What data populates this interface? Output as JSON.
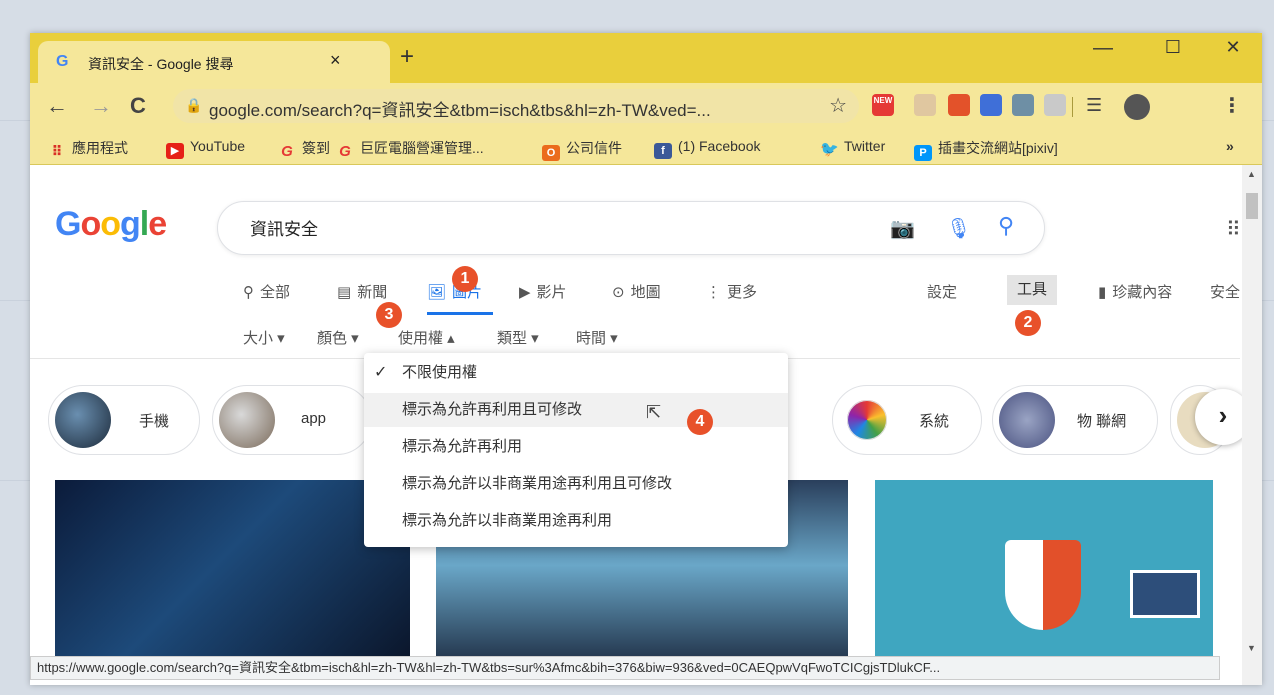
{
  "browser": {
    "tab_title": "資訊安全 - Google 搜尋",
    "tab_favicon": "G",
    "tab_close": "×",
    "new_tab": "+",
    "window_controls": {
      "minimize": "—",
      "maximize": "☐",
      "close": "✕"
    },
    "url": "google.com/search?q=資訊安全&tbm=isch&tbs&hl=zh-TW&ved=...",
    "ext_new_label": "NEW",
    "bookmarks": [
      {
        "label": "應用程式",
        "icon": "apps-grid-icon"
      },
      {
        "label": "YouTube",
        "icon": "youtube-icon"
      },
      {
        "label": "簽到",
        "icon": "g-logo-icon"
      },
      {
        "label": "巨匠電腦營運管理...",
        "icon": "g-logo-icon"
      },
      {
        "label": "公司信件",
        "icon": "office-icon"
      },
      {
        "label": "(1) Facebook",
        "icon": "facebook-icon"
      },
      {
        "label": "Twitter",
        "icon": "twitter-icon"
      },
      {
        "label": "插畫交流網站[pixiv]",
        "icon": "pixiv-icon"
      }
    ],
    "bookmarks_more": "»"
  },
  "search": {
    "logo": "Google",
    "query": "資訊安全",
    "tabs": [
      {
        "label": "全部",
        "icon": "search-icon"
      },
      {
        "label": "新聞",
        "icon": "news-icon"
      },
      {
        "label": "圖片",
        "icon": "image-icon"
      },
      {
        "label": "影片",
        "icon": "video-icon"
      },
      {
        "label": "地圖",
        "icon": "map-pin-icon"
      },
      {
        "label": "更多",
        "icon": "more-icon"
      }
    ],
    "settings": "設定",
    "tools": "工具",
    "collections": "珍藏內容",
    "safe": "安全",
    "filters": [
      "大小 ▾",
      "顏色 ▾",
      "使用權 ▴",
      "類型 ▾",
      "時間 ▾"
    ]
  },
  "chips": [
    "手機",
    "app",
    "系統",
    "物 聯網"
  ],
  "usage_menu": {
    "items": [
      "不限使用權",
      "標示為允許再利用且可修改",
      "標示為允許再利用",
      "標示為允許以非商業用途再利用且可修改",
      "標示為允許以非商業用途再利用"
    ],
    "checked_index": 0,
    "highlighted_index": 1
  },
  "callouts": [
    "1",
    "2",
    "3",
    "4"
  ],
  "status_url": "https://www.google.com/search?q=資訊安全&tbm=isch&hl=zh-TW&hl=zh-TW&tbs=sur%3Afmc&bih=376&biw=936&ved=0CAEQpwVqFwoTCICgjsTDlukCF...",
  "colors": {
    "chrome_yellow": "#e9cf3c",
    "accent_blue": "#1a73e8",
    "callout": "#e8512a"
  }
}
